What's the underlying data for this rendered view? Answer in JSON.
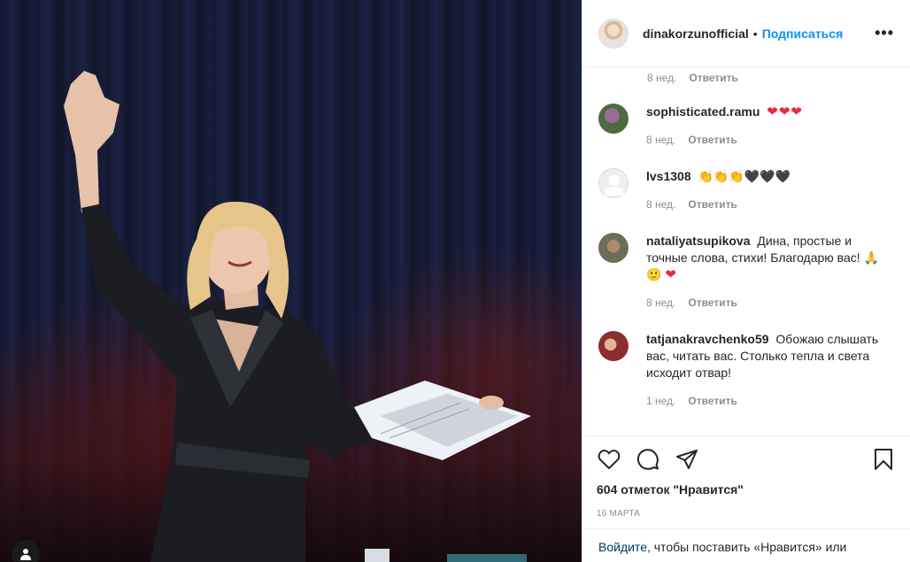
{
  "photo": {
    "alt": ""
  },
  "header": {
    "username": "dinakorzunofficial",
    "separator": "•",
    "follow_label": "Подписаться",
    "more_label": "•••"
  },
  "top_meta": {
    "time": "8 нед.",
    "reply": "Ответить"
  },
  "comments": [
    {
      "user": "sophisticated.ramu",
      "text": "",
      "emoji": "❤❤❤",
      "time": "8 нед.",
      "reply": "Ответить"
    },
    {
      "user": "lvs1308",
      "text": "👏👏👏🖤🖤🖤",
      "emoji": "",
      "time": "8 нед.",
      "reply": "Ответить"
    },
    {
      "user": "nataliyatsupikova",
      "text": "Дина, простые и точные слова, стихи! Благодарю вас! 🙏🙂",
      "emoji": "❤",
      "time": "8 нед.",
      "reply": "Ответить"
    },
    {
      "user": "tatjanakravchenko59",
      "text": "Обожаю слышать вас, читать вас. Столько тепла и света исходит отвар!",
      "emoji": "",
      "time": "1 нед.",
      "reply": "Ответить"
    }
  ],
  "actions": {
    "likes": "604 отметок \"Нравится\"",
    "date": "16 марта"
  },
  "login": {
    "link": "Войдите",
    "rest": ", чтобы поставить «Нравится» или прокомментировать."
  },
  "colors": {
    "accent": "#0095f6",
    "heart": "#ed2a3b",
    "muted": "#8e8e8e"
  },
  "icons": [
    "heart-icon",
    "comment-icon",
    "share-icon",
    "bookmark-icon",
    "more-icon",
    "user-icon"
  ]
}
